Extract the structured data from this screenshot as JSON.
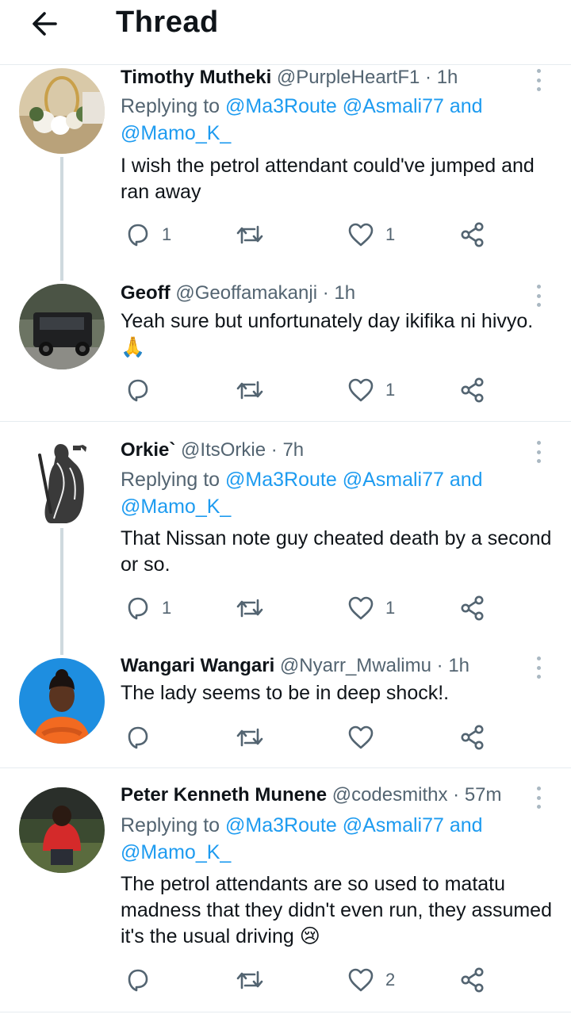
{
  "header": {
    "title": "Thread",
    "back_icon": "arrow-left-icon"
  },
  "colors": {
    "link": "#1d9bf0",
    "secondary_text": "#536471",
    "divider": "#e6ecf0",
    "thread_line": "#cfd9de"
  },
  "tweets": [
    {
      "name": "Timothy Mutheki",
      "handle": "@PurpleHeartF1",
      "dot": "·",
      "time": "1h",
      "replying_prefix": "Replying to",
      "reply_to_1": "@Ma3Route",
      "reply_to_2": "@Asmali77",
      "reply_and": "and",
      "reply_to_3": "@Mamo_K_",
      "text": "I wish the petrol attendant could've jumped and ran away",
      "replies": "1",
      "retweets": "",
      "likes": "1"
    },
    {
      "name": "Geoff",
      "handle": "@Geoffamakanji",
      "dot": "·",
      "time": "1h",
      "text": "Yeah sure but unfortunately day ikifika ni hivyo. 🙏",
      "replies": "",
      "retweets": "",
      "likes": "1"
    },
    {
      "name": "Orkie`",
      "handle": "@ItsOrkie",
      "dot": "·",
      "time": "7h",
      "replying_prefix": "Replying to",
      "reply_to_1": "@Ma3Route",
      "reply_to_2": "@Asmali77",
      "reply_and": "and",
      "reply_to_3": "@Mamo_K_",
      "text": "That Nissan note guy cheated death by a second or so.",
      "replies": "1",
      "retweets": "",
      "likes": "1"
    },
    {
      "name": "Wangari Wangari",
      "handle": "@Nyarr_Mwalimu",
      "dot": "·",
      "time": "1h",
      "text": "The lady seems to be in deep shock!.",
      "replies": "",
      "retweets": "",
      "likes": ""
    },
    {
      "name": "Peter Kenneth Munene",
      "handle": "@codesmithx",
      "dot": "·",
      "time": "57m",
      "replying_prefix": "Replying to",
      "reply_to_1": "@Ma3Route",
      "reply_to_2": "@Asmali77",
      "reply_and": "and",
      "reply_to_3": "@Mamo_K_",
      "text": "The petrol attendants are so used to matatu madness that they didn't even run, they assumed it's the usual driving 😢",
      "replies": "",
      "retweets": "",
      "likes": "2"
    }
  ],
  "action_icons": [
    "reply-icon",
    "retweet-icon",
    "like-icon",
    "share-icon"
  ]
}
